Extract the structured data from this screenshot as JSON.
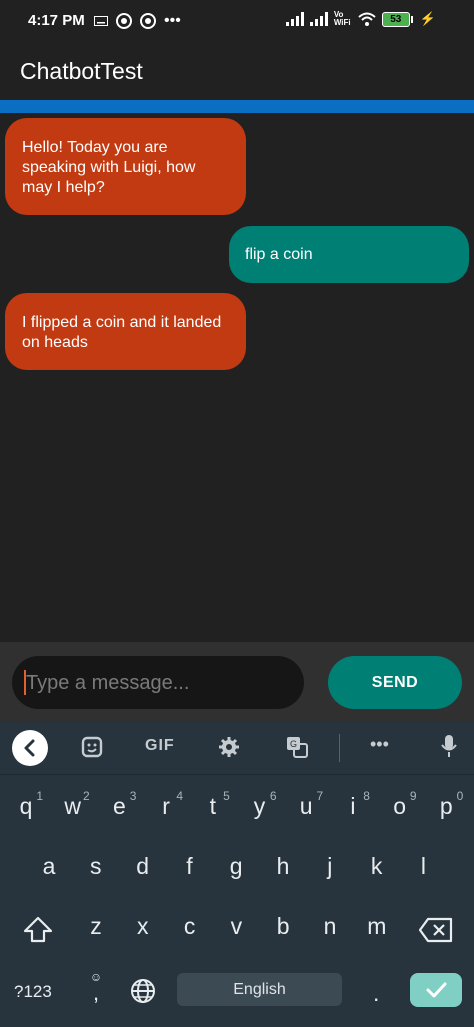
{
  "status": {
    "time": "4:17 PM",
    "battery": "53",
    "volte": "Vo WiFi"
  },
  "app": {
    "title": "ChatbotTest"
  },
  "messages": [
    {
      "sender": "bot",
      "text": "Hello! Today you are speaking with Luigi, how may I help?"
    },
    {
      "sender": "user",
      "text": "flip a coin"
    },
    {
      "sender": "bot",
      "text": "I flipped a coin and it landed on heads"
    }
  ],
  "compose": {
    "placeholder": "Type a message...",
    "send_label": "SEND"
  },
  "keyboard": {
    "toolbar": {
      "gif": "GIF"
    },
    "row1": [
      [
        "q",
        "1"
      ],
      [
        "w",
        "2"
      ],
      [
        "e",
        "3"
      ],
      [
        "r",
        "4"
      ],
      [
        "t",
        "5"
      ],
      [
        "y",
        "6"
      ],
      [
        "u",
        "7"
      ],
      [
        "i",
        "8"
      ],
      [
        "o",
        "9"
      ],
      [
        "p",
        "0"
      ]
    ],
    "row2": [
      "a",
      "s",
      "d",
      "f",
      "g",
      "h",
      "j",
      "k",
      "l"
    ],
    "row3": [
      "z",
      "x",
      "c",
      "v",
      "b",
      "n",
      "m"
    ],
    "symbols": "?123",
    "comma": ",",
    "space": "English",
    "period": "."
  },
  "colors": {
    "bot": "#c23a12",
    "user": "#007f74",
    "accent": "#0a6fc2"
  }
}
